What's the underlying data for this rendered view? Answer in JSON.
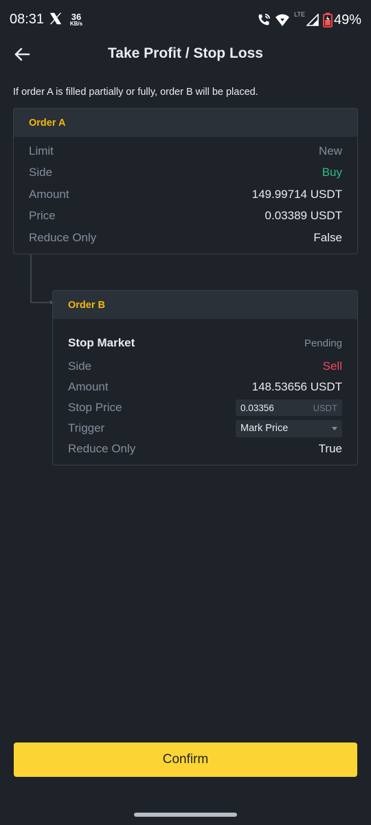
{
  "status_bar": {
    "time": "08:31",
    "speed_value": "36",
    "speed_unit": "KB/s",
    "network": "LTE",
    "battery": "49%"
  },
  "header": {
    "title": "Take Profit / Stop Loss"
  },
  "info_text": "If order A is filled partially or fully, order B will be placed.",
  "order_a": {
    "title": "Order A",
    "type_label": "Limit",
    "status": "New",
    "side_label": "Side",
    "side_value": "Buy",
    "amount_label": "Amount",
    "amount_value": "149.99714 USDT",
    "price_label": "Price",
    "price_value": "0.03389 USDT",
    "reduce_only_label": "Reduce Only",
    "reduce_only_value": "False"
  },
  "order_b": {
    "title": "Order B",
    "type_label": "Stop Market",
    "status": "Pending",
    "side_label": "Side",
    "side_value": "Sell",
    "amount_label": "Amount",
    "amount_value": "148.53656 USDT",
    "stop_price_label": "Stop Price",
    "stop_price_value": "0.03356",
    "stop_price_unit": "USDT",
    "trigger_label": "Trigger",
    "trigger_value": "Mark Price",
    "reduce_only_label": "Reduce Only",
    "reduce_only_value": "True"
  },
  "confirm_label": "Confirm",
  "colors": {
    "background": "#1e2329",
    "card_header": "#2b3139",
    "accent": "#f0b90b",
    "buy": "#2ebd85",
    "sell": "#f6465d",
    "confirm": "#fcd535"
  }
}
